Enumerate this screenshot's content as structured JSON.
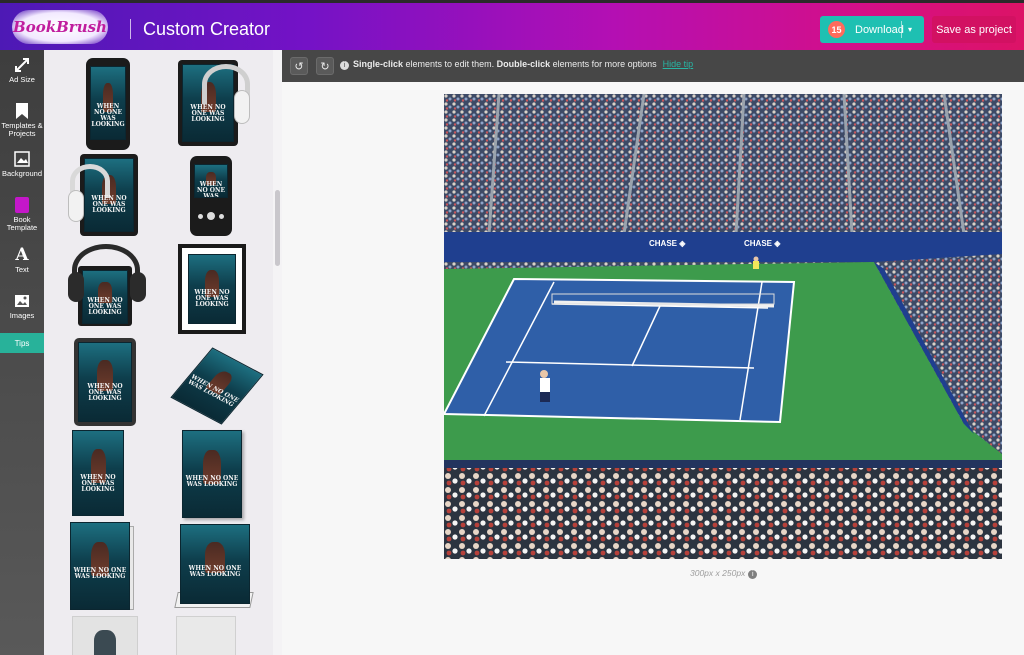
{
  "header": {
    "logo_text": "BookBrush",
    "app_title": "Custom Creator",
    "download": {
      "badge": "15",
      "label": "Download",
      "caret": "▾"
    },
    "save_label": "Save as project"
  },
  "rail": {
    "items": [
      {
        "label": "Ad Size",
        "icon": "resize-arrows-icon"
      },
      {
        "label": "Templates & Projects",
        "icon": "bookmark-icon"
      },
      {
        "label": "Background",
        "icon": "background-image-icon"
      },
      {
        "label": "Book Template",
        "icon": "book-template-icon"
      },
      {
        "label": "Text",
        "icon": "text-icon"
      },
      {
        "label": "Images",
        "icon": "image-icon"
      }
    ],
    "tips_label": "Tips"
  },
  "panel": {
    "cover_title": "WHEN NO ONE WAS LOOKING"
  },
  "toolbar": {
    "undo_icon": "↺",
    "redo_icon": "↻",
    "hint_part1": "Single-click",
    "hint_part2": " elements to edit them. ",
    "hint_part3": "Double-click",
    "hint_part4": " elements for more options",
    "hint_link": "Hide tip"
  },
  "canvas": {
    "size_label": "300px x 250px",
    "info_glyph": "i"
  },
  "colors": {
    "accent_teal": "#1ec0b2",
    "save_pink": "#d21162",
    "court_blue": "#2f5fa8",
    "court_green": "#3d9b4c"
  }
}
